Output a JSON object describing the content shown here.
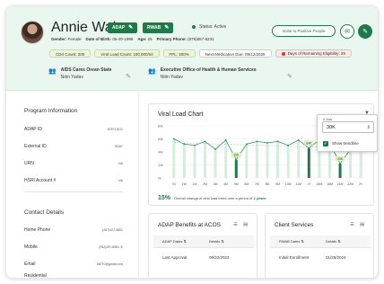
{
  "profile": {
    "name": "Annie Walter",
    "badges": [
      {
        "label": "ADAP"
      },
      {
        "label": "RWAB"
      }
    ],
    "status": "Status: Active",
    "invite_label": "Invite to Positive People",
    "meta": {
      "gender_label": "Gender:",
      "gender": "Female",
      "dob_label": "Date of Birth:",
      "dob": "06-20-1999",
      "age_label": "Age:",
      "age": "25",
      "phone_label": "Primary Phone:",
      "phone": "(878)657-8231"
    },
    "pills": [
      "CD4 Count: 200",
      "Viral Load Count: 100,000/ml",
      "FPL: 300%",
      "Next Medication Due: 09/12/2025",
      "Days of Remaining Eligibility: 29"
    ],
    "contacts": [
      {
        "org": "AIDS Cares Orean State",
        "person": "Nitin Yadav"
      },
      {
        "org": "Executive Office of Health & Human Services",
        "person": "Nitin Yadav"
      }
    ]
  },
  "program_info": {
    "title": "Program Information",
    "rows": [
      {
        "label": "ADAP ID",
        "value": "878713211"
      },
      {
        "label": "External ID",
        "value": "78167"
      },
      {
        "label": "URN",
        "value": "NA"
      },
      {
        "label": "HSRI Account #",
        "value": "NA"
      }
    ]
  },
  "contact_details": {
    "title": "Contact Details",
    "rows": [
      {
        "label": "Home Phone",
        "value": "(267)427-4861"
      },
      {
        "label": "Mobile",
        "value": "(252)257-8981"
      },
      {
        "label": "Email",
        "value": "68770@gmail.com"
      },
      {
        "label": "Residential",
        "value": ""
      }
    ]
  },
  "chart": {
    "title": "Viral Load Chart",
    "summary_pct": "15%",
    "summary_text": "Overall change in viral load trend over a period of",
    "summary_period": "2 years"
  },
  "chart_data": {
    "type": "bar",
    "title": "Viral Load Chart",
    "categories": [
      "7D",
      "1W",
      "1M",
      "2M",
      "3M",
      "4M",
      "5M",
      "6M",
      "7M",
      "8M",
      "9M",
      "10M",
      "11M",
      "1Y",
      "15M",
      "18M",
      "21M",
      "22M",
      "2Y"
    ],
    "ylim": [
      0,
      80
    ],
    "y_ticks": [
      "0k",
      "20k",
      "40k",
      "60k",
      "80k"
    ],
    "series": [
      {
        "values": [
          60,
          52,
          50,
          56,
          44,
          58,
          28,
          52,
          56,
          54,
          56,
          50,
          58,
          46,
          58,
          54,
          22,
          44,
          46
        ]
      }
    ],
    "highlighted": [
      {
        "category": "5M",
        "label": "32K"
      },
      {
        "category": "1Y",
        "label": "64K"
      },
      {
        "category": "21M",
        "label": "30K"
      }
    ],
    "trendline": true
  },
  "popover": {
    "label": "X-Axis",
    "selected": "30K",
    "checkbox_label": "Show trendline"
  },
  "benefits_card": {
    "title": "ADAP Benefits at ACOS",
    "headers": [
      "ADAP Dates",
      "Details"
    ],
    "row": [
      "Last Approval",
      "09/22/2023"
    ]
  },
  "services_card": {
    "title": "Client Services",
    "headers": [
      "RWAB Dates",
      "Details"
    ],
    "row": [
      "Initial Enrollment",
      "01/25/2024"
    ]
  },
  "colors": {
    "brand": "#1e7a4b",
    "header_bg": "#eaf7ee",
    "bar_light": "#d4eedd",
    "alert": "#d9362b"
  }
}
